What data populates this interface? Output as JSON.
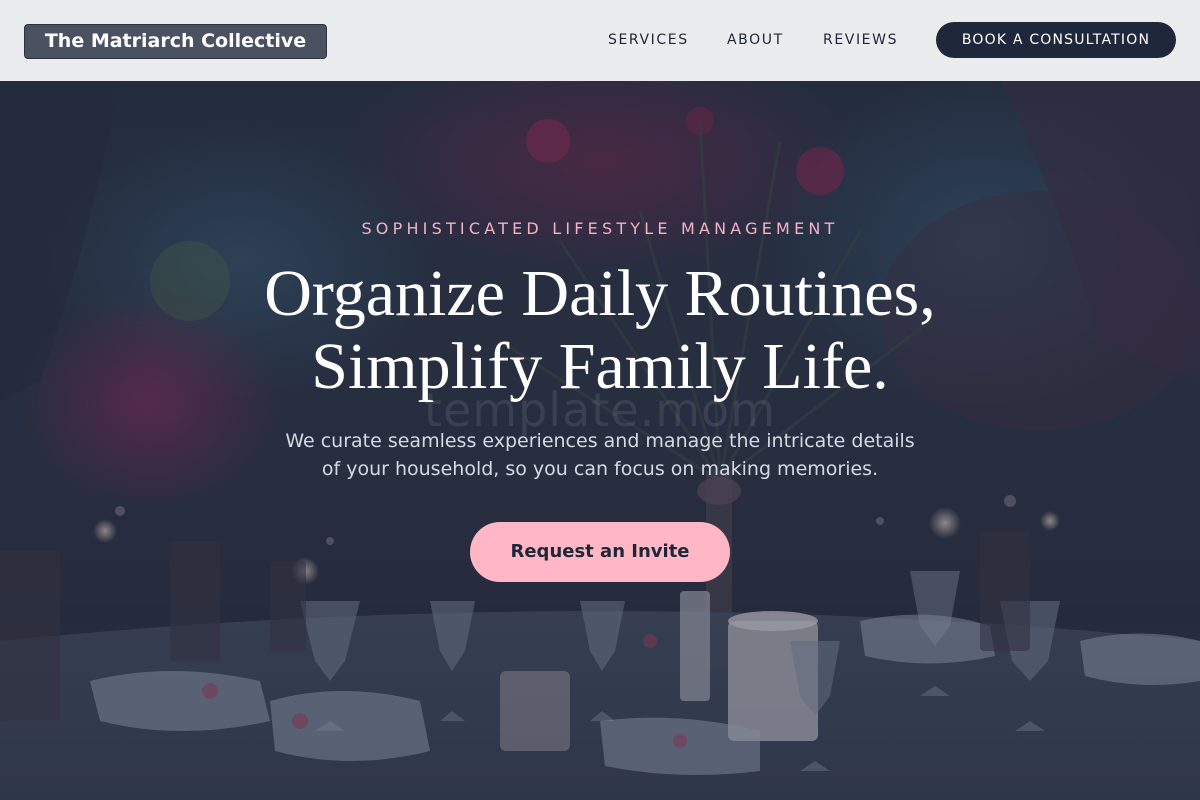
{
  "header": {
    "brand": "The Matriarch Collective",
    "nav": [
      "SERVICES",
      "ABOUT",
      "REVIEWS"
    ],
    "cta_label": "BOOK A CONSULTATION"
  },
  "hero": {
    "eyebrow": "SOPHISTICATED LIFESTYLE MANAGEMENT",
    "headline_lines": [
      "Organize Daily Routines,",
      "Simplify Family Life."
    ],
    "subtext_lines": [
      "We curate seamless experiences and manage the intricate details",
      "of your household, so you can focus on making memories."
    ],
    "watermark": "template.mom",
    "button_label": "Request an Invite",
    "background_image": "dimly-lit-banquet-table-with-glassware-and-flowers"
  },
  "colors": {
    "header_bg": "#ebecee",
    "navy": "#1e283a",
    "pink_accent": "#ffb7c5",
    "eyebrow_pink": "#f2b3c4"
  }
}
